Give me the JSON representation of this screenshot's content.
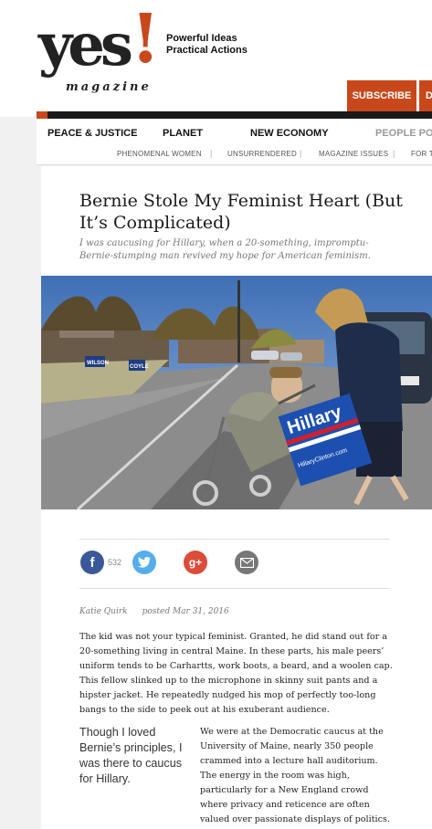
{
  "header": {
    "logo_text": "yes",
    "logo_bang": "!",
    "logo_sub": "magazine",
    "tagline": [
      "Powerful Ideas",
      "Practical Actions"
    ],
    "subscribe_label": "SUBSCRIBE",
    "donate_label": "D"
  },
  "nav": {
    "items": [
      "PEACE & JUSTICE",
      "PLANET",
      "NEW ECONOMY",
      "PEOPLE POW"
    ]
  },
  "subnav": {
    "items": [
      "PHENOMENAL WOMEN",
      "UNSURRENDERED",
      "MAGAZINE ISSUES",
      "FOR TE"
    ]
  },
  "article": {
    "title": "Bernie Stole My Feminist Heart (But It’s Complicated)",
    "dek": "I was caucusing for Hillary, when a 20-something, impromptu-Bernie-stumping man revived my hope for American feminism.",
    "photo_signs": [
      "WILSON",
      "COYLE",
      "Hillary",
      "HillaryClinton.com"
    ],
    "share": {
      "facebook_count": "532"
    },
    "author": "Katie Quirk",
    "posted": "posted Mar 31, 2016",
    "paragraph1": "The kid was not your typical feminist. Granted, he did stand out for a 20-something living in central Maine. In these parts, his male peers’ uniform tends to be Carhartts, work boots, a beard, and a woolen cap. This fellow slinked up to the microphone in skinny suit pants and a hipster jacket. He repeatedly nudged his mop of perfectly too-long bangs to the side to peek out at his exuberant audience.",
    "pullquote": "Though I loved Bernie’s principles, I was there to caucus for Hillary.",
    "paragraph2": "We were at the Democratic caucus at the University of Maine, nearly 350 people crammed into a lecture hall auditorium. The energy in the room was high, particularly for a New England crowd where privacy and reticence are often valued over passionate displays of politics."
  },
  "colors": {
    "accent": "#c8481c",
    "facebook": "#3b5998",
    "twitter": "#55acee",
    "googleplus": "#dd4b39",
    "email": "#777777"
  }
}
